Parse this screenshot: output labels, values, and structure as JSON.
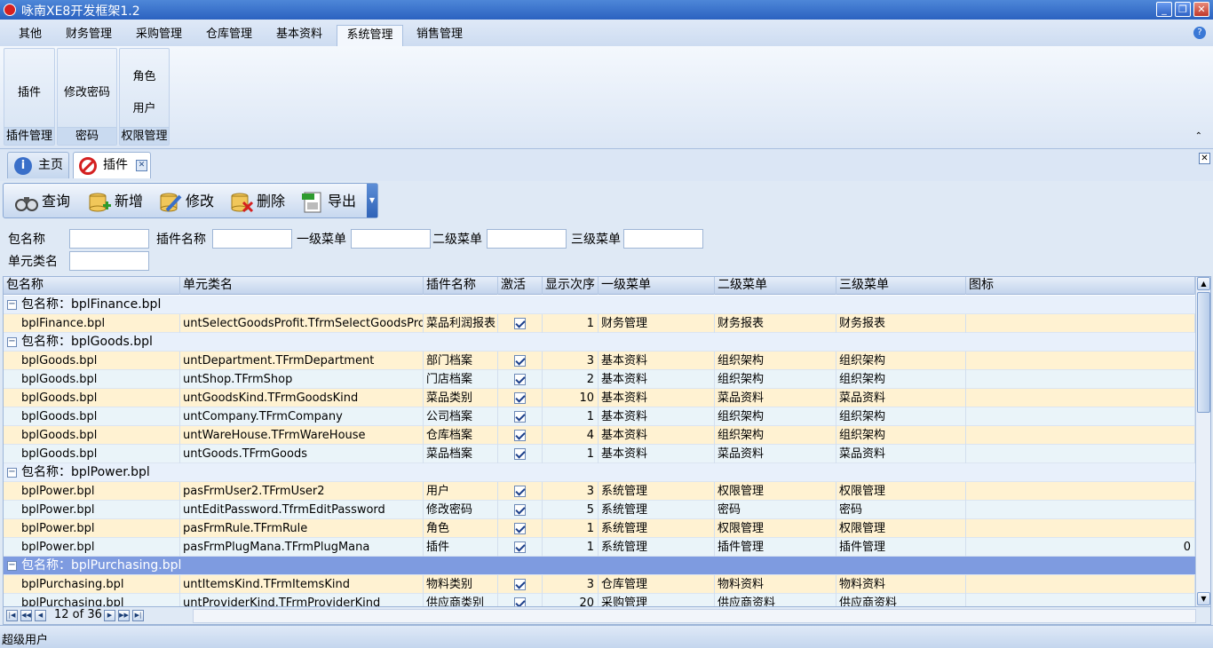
{
  "window": {
    "title": "咏南XE8开发框架1.2"
  },
  "ribbon_tabs": [
    "其他",
    "财务管理",
    "采购管理",
    "仓库管理",
    "基本资料",
    "系统管理",
    "销售管理"
  ],
  "ribbon_active_tab": "系统管理",
  "ribbon_groups": [
    {
      "label": "插件管理",
      "buttons": [
        "插件"
      ]
    },
    {
      "label": "密码",
      "buttons": [
        "修改密码"
      ]
    },
    {
      "label": "权限管理",
      "buttons": [
        "角色",
        "用户"
      ]
    }
  ],
  "doc_tabs": [
    {
      "label": "主页",
      "icon": "info-icon"
    },
    {
      "label": "插件",
      "icon": "stop-icon",
      "active": true
    }
  ],
  "toolbar": {
    "query": "查询",
    "add": "新增",
    "edit": "修改",
    "delete": "删除",
    "export": "导出"
  },
  "filters": {
    "package_name": {
      "label": "包名称",
      "value": ""
    },
    "plugin_name": {
      "label": "插件名称",
      "value": ""
    },
    "menu1": {
      "label": "一级菜单",
      "value": ""
    },
    "menu2": {
      "label": "二级菜单",
      "value": ""
    },
    "menu3": {
      "label": "三级菜单",
      "value": ""
    },
    "unit_class": {
      "label": "单元类名",
      "value": ""
    }
  },
  "grid": {
    "columns": [
      "包名称",
      "单元类名",
      "插件名称",
      "激活",
      "显示次序",
      "一级菜单",
      "二级菜单",
      "三级菜单",
      "图标"
    ],
    "rows": [
      {
        "type": "group",
        "text": "包名称：bplFinance.bpl"
      },
      {
        "type": "data",
        "pkg": "bplFinance.bpl",
        "unit": "untSelectGoodsProfit.TfrmSelectGoodsProfit",
        "plugin": "菜品利润报表",
        "active": true,
        "order": "1",
        "m1": "财务管理",
        "m2": "财务报表",
        "m3": "财务报表",
        "icon": ""
      },
      {
        "type": "group",
        "text": "包名称：bplGoods.bpl"
      },
      {
        "type": "data",
        "pkg": "bplGoods.bpl",
        "unit": "untDepartment.TFrmDepartment",
        "plugin": "部门档案",
        "active": true,
        "order": "3",
        "m1": "基本资料",
        "m2": "组织架构",
        "m3": "组织架构",
        "icon": ""
      },
      {
        "type": "data",
        "pkg": "bplGoods.bpl",
        "unit": "untShop.TFrmShop",
        "plugin": "门店档案",
        "active": true,
        "order": "2",
        "m1": "基本资料",
        "m2": "组织架构",
        "m3": "组织架构",
        "icon": ""
      },
      {
        "type": "data",
        "pkg": "bplGoods.bpl",
        "unit": "untGoodsKind.TFrmGoodsKind",
        "plugin": "菜品类别",
        "active": true,
        "order": "10",
        "m1": "基本资料",
        "m2": "菜品资料",
        "m3": "菜品资料",
        "icon": ""
      },
      {
        "type": "data",
        "pkg": "bplGoods.bpl",
        "unit": "untCompany.TFrmCompany",
        "plugin": "公司档案",
        "active": true,
        "order": "1",
        "m1": "基本资料",
        "m2": "组织架构",
        "m3": "组织架构",
        "icon": ""
      },
      {
        "type": "data",
        "pkg": "bplGoods.bpl",
        "unit": "untWareHouse.TFrmWareHouse",
        "plugin": "仓库档案",
        "active": true,
        "order": "4",
        "m1": "基本资料",
        "m2": "组织架构",
        "m3": "组织架构",
        "icon": ""
      },
      {
        "type": "data",
        "pkg": "bplGoods.bpl",
        "unit": "untGoods.TFrmGoods",
        "plugin": "菜品档案",
        "active": true,
        "order": "1",
        "m1": "基本资料",
        "m2": "菜品资料",
        "m3": "菜品资料",
        "icon": ""
      },
      {
        "type": "group",
        "text": "包名称：bplPower.bpl"
      },
      {
        "type": "data",
        "pkg": "bplPower.bpl",
        "unit": "pasFrmUser2.TFrmUser2",
        "plugin": "用户",
        "active": true,
        "order": "3",
        "m1": "系统管理",
        "m2": "权限管理",
        "m3": "权限管理",
        "icon": ""
      },
      {
        "type": "data",
        "pkg": "bplPower.bpl",
        "unit": "untEditPassword.TfrmEditPassword",
        "plugin": "修改密码",
        "active": true,
        "order": "5",
        "m1": "系统管理",
        "m2": "密码",
        "m3": "密码",
        "icon": ""
      },
      {
        "type": "data",
        "pkg": "bplPower.bpl",
        "unit": "pasFrmRule.TFrmRule",
        "plugin": "角色",
        "active": true,
        "order": "1",
        "m1": "系统管理",
        "m2": "权限管理",
        "m3": "权限管理",
        "icon": ""
      },
      {
        "type": "data",
        "pkg": "bplPower.bpl",
        "unit": "pasFrmPlugMana.TFrmPlugMana",
        "plugin": "插件",
        "active": true,
        "order": "1",
        "m1": "系统管理",
        "m2": "插件管理",
        "m3": "插件管理",
        "icon": "0"
      },
      {
        "type": "group",
        "text": "包名称：bplPurchasing.bpl",
        "selected": true
      },
      {
        "type": "data",
        "pkg": "bplPurchasing.bpl",
        "unit": "untItemsKind.TFrmItemsKind",
        "plugin": "物料类别",
        "active": true,
        "order": "3",
        "m1": "仓库管理",
        "m2": "物料资料",
        "m3": "物料资料",
        "icon": ""
      },
      {
        "type": "data",
        "pkg": "bplPurchasing.bpl",
        "unit": "untProviderKind.TFrmProviderKind",
        "plugin": "供应商类别",
        "active": true,
        "order": "20",
        "m1": "采购管理",
        "m2": "供应商资料",
        "m3": "供应商资料",
        "icon": ""
      }
    ],
    "navigator": "12 of 36"
  },
  "status": {
    "user": "超级用户"
  }
}
